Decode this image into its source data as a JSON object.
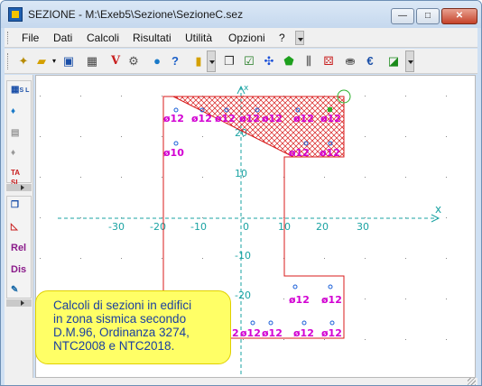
{
  "window": {
    "title": "SEZIONE - M:\\Exeb5\\Sezione\\SezioneC.sez",
    "minimize_glyph": "—",
    "maximize_glyph": "□",
    "close_glyph": "✕"
  },
  "menu": {
    "file": "File",
    "dati": "Dati",
    "calcoli": "Calcoli",
    "risultati": "Risultati",
    "utilita": "Utilità",
    "opzioni": "Opzioni",
    "help": "?"
  },
  "toolbar_icons": [
    "new-doc-icon",
    "open-folder-icon",
    "dropdown-arrow-icon",
    "save-icon",
    "calculator-icon",
    "v-icon",
    "settings-gear-icon",
    "globe-icon",
    "help-icon",
    "ruler-icon",
    "windows-icon",
    "check-icon",
    "points-icon",
    "polygon-icon",
    "bars-icon",
    "dice-icon",
    "weight-icon",
    "euro-icon",
    "paint-icon"
  ],
  "sidebar": {
    "sl_label": "S\nL",
    "ta_label": "TA\nSL",
    "rel_label": "Rel",
    "dis_label": "Dis"
  },
  "plot": {
    "x_axis_label": "x",
    "y_axis_label": "x",
    "x_ticks": [
      "-30",
      "-20",
      "-10",
      "0",
      "10",
      "20",
      "30"
    ],
    "y_ticks": [
      "20",
      "10",
      "-10",
      "-20"
    ],
    "bar_label": "ø12",
    "bar_label_small": "ø10",
    "bottom_left_label": "2"
  },
  "info": {
    "text_line1": "Calcoli di sezioni in edifici",
    "text_line2": "in zona sismica secondo",
    "text_line3": "D.M.96, Ordinanza 3274,",
    "text_line4": "NTC2008 e NTC2018."
  },
  "colors": {
    "section_outline": "#d81b1b",
    "bar_label": "#d200d2",
    "axis": "#1aa3a3",
    "info_text": "#1a3fa0",
    "info_bg": "#ffff66"
  }
}
